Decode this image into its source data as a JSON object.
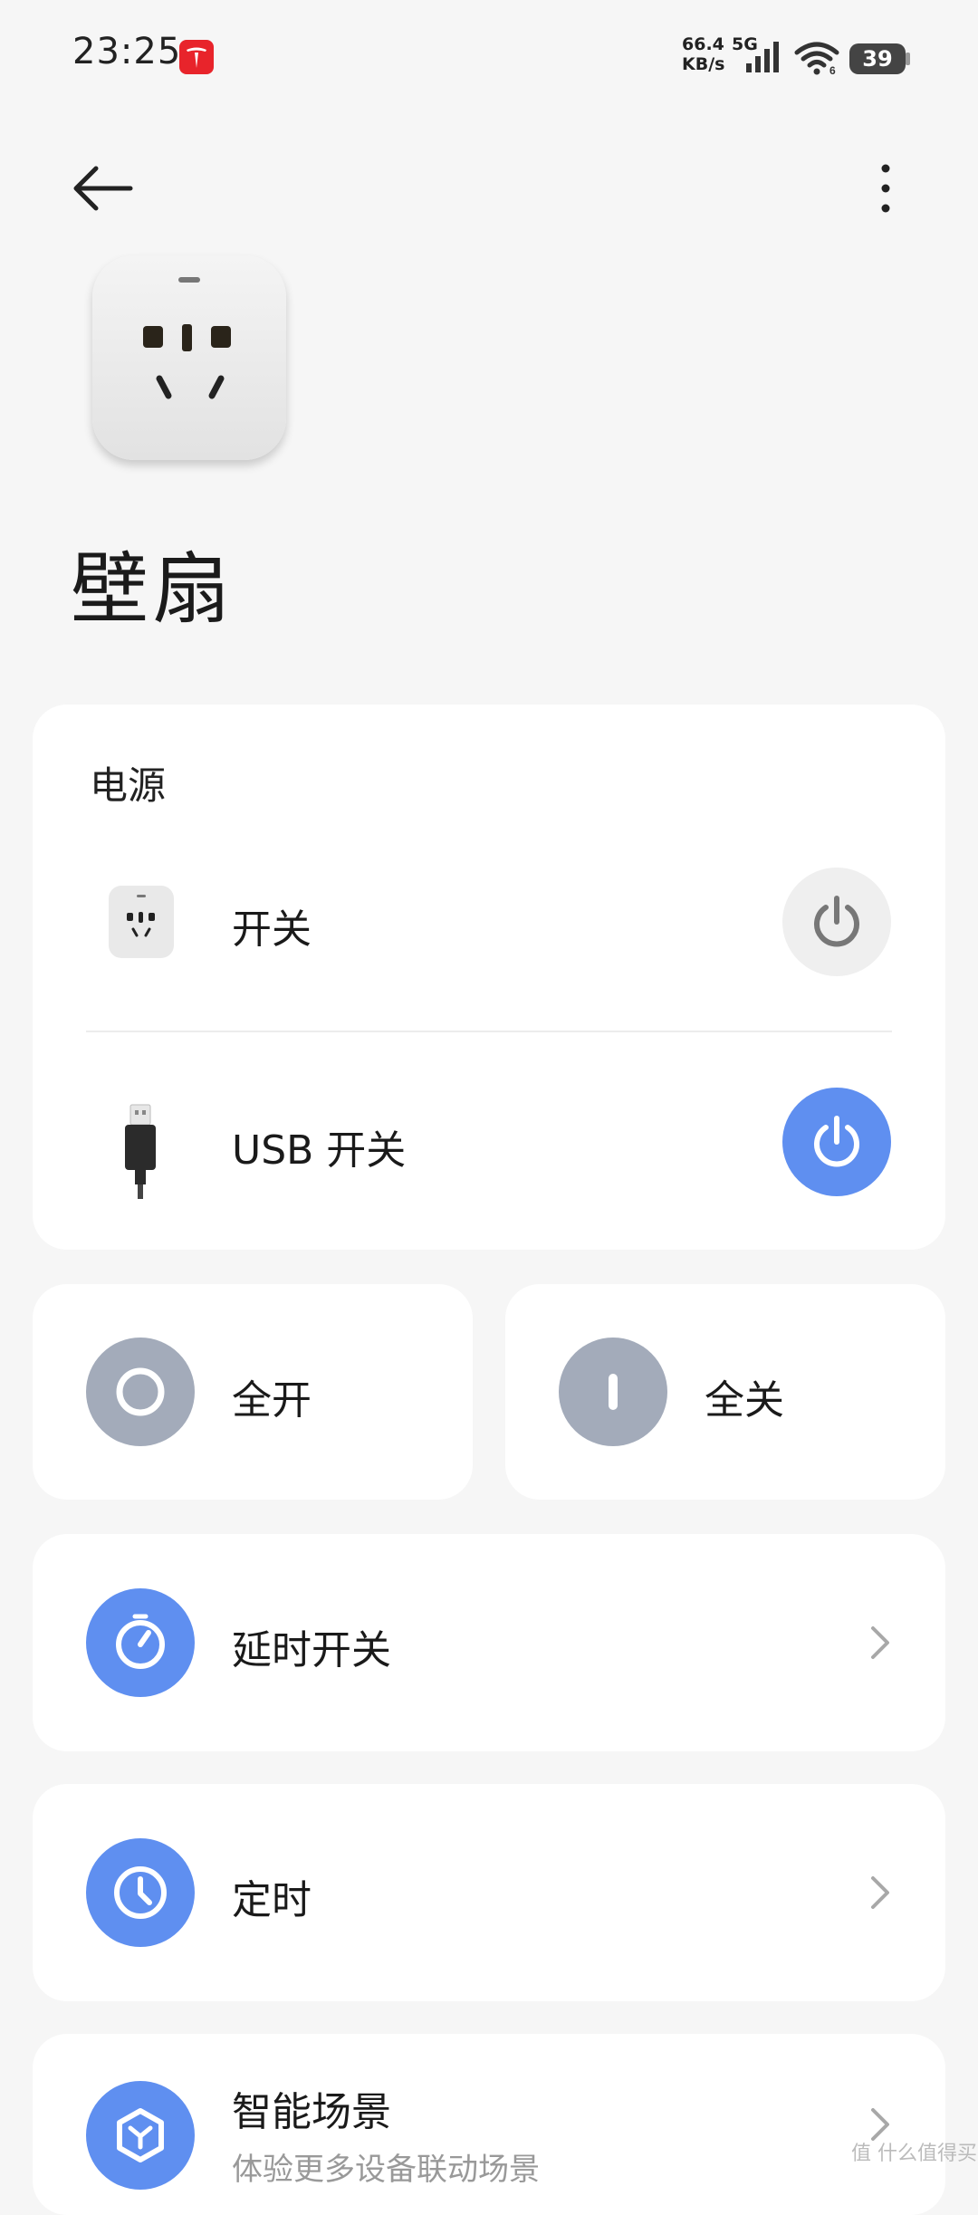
{
  "status_bar": {
    "time": "23:25",
    "speed_value": "66.4",
    "speed_unit": "KB/s",
    "network": "5G",
    "battery": "39",
    "icons": [
      "tesla-app-icon",
      "signal-icon",
      "wifi-icon",
      "battery-icon"
    ]
  },
  "header": {
    "back_icon": "arrow-left-icon",
    "more_icon": "more-vertical-icon"
  },
  "device": {
    "image": "power-socket",
    "name": "壁扇"
  },
  "power_section": {
    "label": "电源",
    "items": [
      {
        "label": "开关",
        "icon": "socket-icon",
        "state": "off"
      },
      {
        "label": "USB 开关",
        "icon": "usb-icon",
        "state": "on"
      }
    ]
  },
  "all_on": {
    "label": "全开",
    "icon": "circle-on-icon"
  },
  "all_off": {
    "label": "全关",
    "icon": "bar-off-icon"
  },
  "delay": {
    "label": "延时开关",
    "icon": "stopwatch-icon"
  },
  "timer": {
    "label": "定时",
    "icon": "clock-icon"
  },
  "scene": {
    "label": "智能场景",
    "subtitle": "体验更多设备联动场景",
    "icon": "scene-hex-icon"
  },
  "watermark": "值 什么值得买",
  "colors": {
    "accent": "#5f8ff0",
    "inactive": "#a3abba",
    "background": "#f6f6f6",
    "card": "#ffffff"
  }
}
